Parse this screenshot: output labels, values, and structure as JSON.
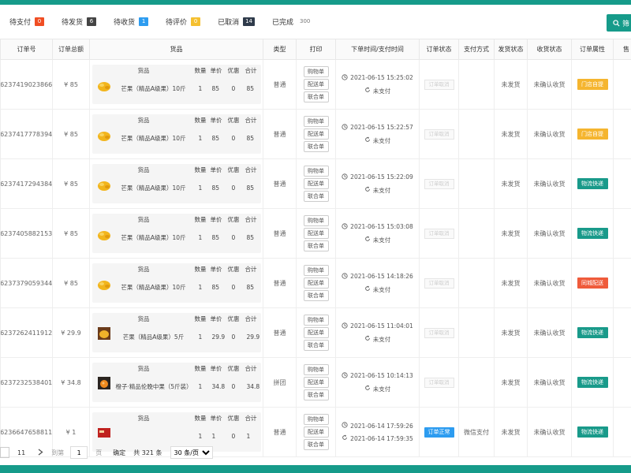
{
  "tabs": [
    {
      "label": "待支付",
      "count": "0",
      "color": "#f04e23"
    },
    {
      "label": "待发货",
      "count": "6",
      "color": "#444444"
    },
    {
      "label": "待收货",
      "count": "1",
      "color": "#2d9cf0"
    },
    {
      "label": "待评价",
      "count": "0",
      "color": "#f5c030"
    },
    {
      "label": "已取消",
      "count": "14",
      "color": "#2f3b4b"
    },
    {
      "label": "已完成",
      "count": "300",
      "color": ""
    }
  ],
  "search_label": "筛",
  "columns": [
    "订单号",
    "订单总额",
    "货品",
    "类型",
    "打印",
    "下单时间/支付时间",
    "订单状态",
    "支付方式",
    "发货状态",
    "收货状态",
    "订单属性",
    "售"
  ],
  "goods_headers": {
    "goods": "货品",
    "qty": "数量",
    "price": "单价",
    "discount": "优惠",
    "total": "合计"
  },
  "print_buttons": [
    "购物单",
    "配送单",
    "联合单"
  ],
  "status_placeholder": "订单取消",
  "rows": [
    {
      "no": "16237419023866",
      "total": "¥ 85",
      "goods": "芒果（精品A级果）10斤",
      "thumb": "mango",
      "qty": "1",
      "price": "85",
      "discount": "0",
      "sum": "85",
      "type": "普通",
      "order_time": "2021-06-15 15:25:02",
      "pay_time": "未支付",
      "status": "订单取消",
      "status_active": false,
      "pay_method": "",
      "ship": "未发货",
      "recv": "未确认收货",
      "attr": "门店自提",
      "attr_color": "yellow"
    },
    {
      "no": "16237417778394",
      "total": "¥ 85",
      "goods": "芒果（精品A级果）10斤",
      "thumb": "mango",
      "qty": "1",
      "price": "85",
      "discount": "0",
      "sum": "85",
      "type": "普通",
      "order_time": "2021-06-15 15:22:57",
      "pay_time": "未支付",
      "status": "订单取消",
      "status_active": false,
      "pay_method": "",
      "ship": "未发货",
      "recv": "未确认收货",
      "attr": "门店自提",
      "attr_color": "yellow"
    },
    {
      "no": "16237417294384",
      "total": "¥ 85",
      "goods": "芒果（精品A级果）10斤",
      "thumb": "mango",
      "qty": "1",
      "price": "85",
      "discount": "0",
      "sum": "85",
      "type": "普通",
      "order_time": "2021-06-15 15:22:09",
      "pay_time": "未支付",
      "status": "订单取消",
      "status_active": false,
      "pay_method": "",
      "ship": "未发货",
      "recv": "未确认收货",
      "attr": "物流快递",
      "attr_color": "green"
    },
    {
      "no": "16237405882153",
      "total": "¥ 85",
      "goods": "芒果（精品A级果）10斤",
      "thumb": "mango",
      "qty": "1",
      "price": "85",
      "discount": "0",
      "sum": "85",
      "type": "普通",
      "order_time": "2021-06-15 15:03:08",
      "pay_time": "未支付",
      "status": "订单取消",
      "status_active": false,
      "pay_method": "",
      "ship": "未发货",
      "recv": "未确认收货",
      "attr": "物流快递",
      "attr_color": "green"
    },
    {
      "no": "16237379059344",
      "total": "¥ 85",
      "goods": "芒果（精品A级果）10斤",
      "thumb": "mango",
      "qty": "1",
      "price": "85",
      "discount": "0",
      "sum": "85",
      "type": "普通",
      "order_time": "2021-06-15 14:18:26",
      "pay_time": "未支付",
      "status": "订单取消",
      "status_active": false,
      "pay_method": "",
      "ship": "未发货",
      "recv": "未确认收货",
      "attr": "同城配送",
      "attr_color": "red"
    },
    {
      "no": "16237262411912",
      "total": "¥ 29.9",
      "goods": "芒果（精品A级果）5斤",
      "thumb": "mango-box",
      "qty": "1",
      "price": "29.9",
      "discount": "0",
      "sum": "29.9",
      "type": "普通",
      "order_time": "2021-06-15 11:04:01",
      "pay_time": "未支付",
      "status": "订单取消",
      "status_active": false,
      "pay_method": "",
      "ship": "未发货",
      "recv": "未确认收货",
      "attr": "物流快递",
      "attr_color": "green"
    },
    {
      "no": "16237232538401",
      "total": "¥ 34.8",
      "goods": "橙子·精品伦晚中果（5斤装）",
      "thumb": "orange",
      "qty": "1",
      "price": "34.8",
      "discount": "0",
      "sum": "34.8",
      "type": "拼团",
      "order_time": "2021-06-15 10:14:13",
      "pay_time": "未支付",
      "status": "订单取消",
      "status_active": false,
      "pay_method": "",
      "ship": "未发货",
      "recv": "未确认收货",
      "attr": "物流快递",
      "attr_color": "green"
    },
    {
      "no": "16236647658811",
      "total": "¥ 1",
      "goods": "",
      "thumb": "red-box",
      "qty": "1",
      "price": "1",
      "discount": "0",
      "sum": "1",
      "type": "普通",
      "order_time": "2021-06-14 17:59:26",
      "pay_time": "2021-06-14 17:59:35",
      "status": "订单正常",
      "status_active": true,
      "pay_method": "微信支付",
      "ship": "未发货",
      "recv": "未确认收货",
      "attr": "物流快递",
      "attr_color": "green"
    }
  ],
  "pager": {
    "page_left": "11",
    "goto_label": "到第",
    "goto_value": "1",
    "page_unit": "页",
    "confirm": "确定",
    "total": "共 321 条",
    "page_size": "30 条/页"
  }
}
